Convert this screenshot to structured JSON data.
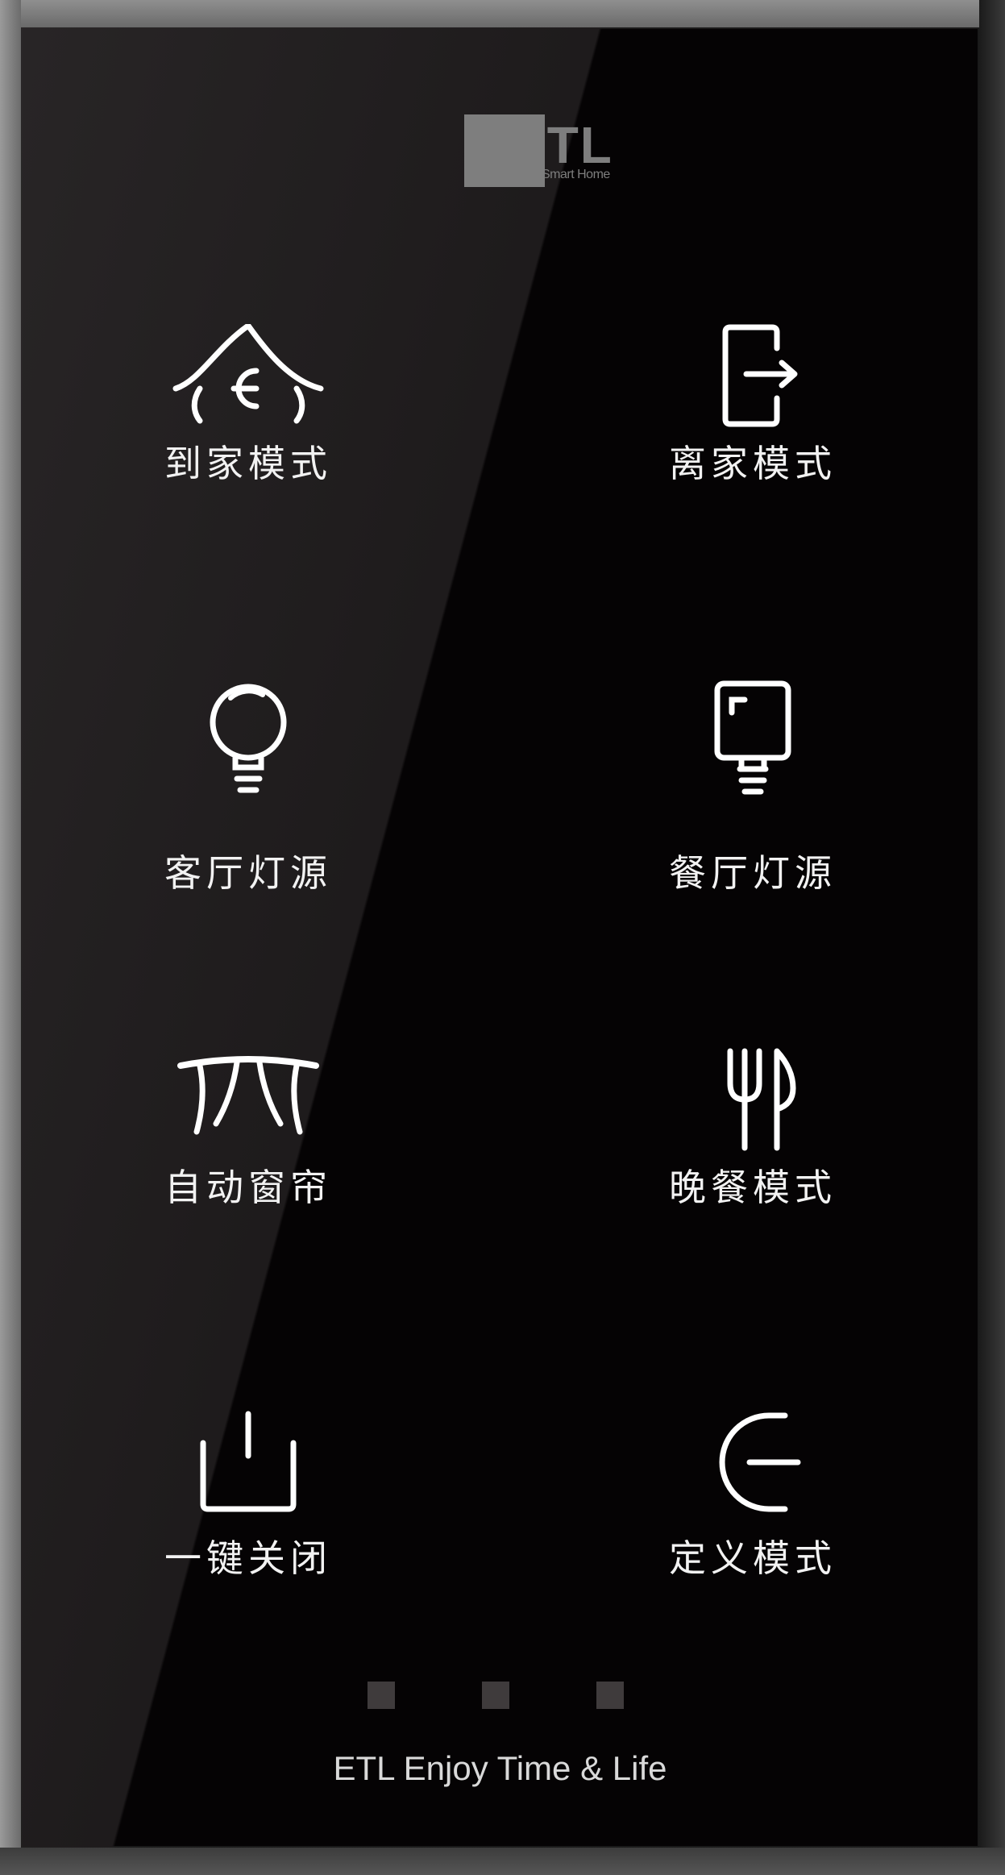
{
  "logo": {
    "brand": "ETL",
    "sub": "Smart Home"
  },
  "buttons": [
    {
      "label": "到家模式",
      "icon": "home-arrive-icon"
    },
    {
      "label": "离家模式",
      "icon": "exit-door-icon"
    },
    {
      "label": "客厅灯源",
      "icon": "bulb-icon"
    },
    {
      "label": "餐厅灯源",
      "icon": "lamp-icon"
    },
    {
      "label": "自动窗帘",
      "icon": "curtain-icon"
    },
    {
      "label": "晚餐模式",
      "icon": "dinner-icon"
    },
    {
      "label": "一键关闭",
      "icon": "power-off-icon"
    },
    {
      "label": "定义模式",
      "icon": "custom-mode-icon"
    }
  ],
  "pagination": {
    "dots": 3
  },
  "footer": {
    "tagline": "ETL Enjoy Time & Life"
  },
  "colors": {
    "glass": "#050304",
    "text": "#f2f2f2",
    "logo": "#7e7e7e",
    "dot": "#3f3b3c"
  }
}
